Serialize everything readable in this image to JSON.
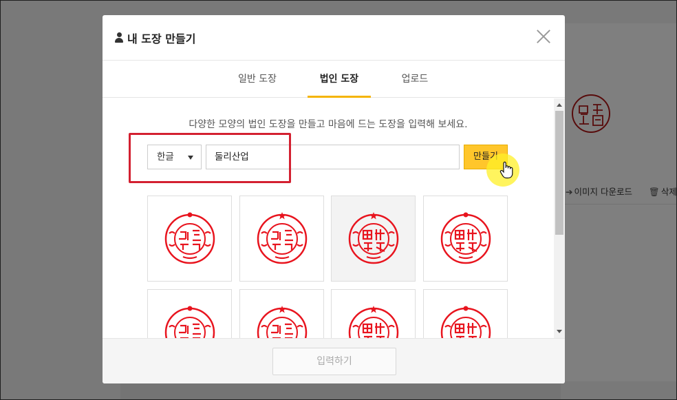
{
  "background": {
    "actions": {
      "download_label": "이미지 다운로드",
      "delete_label": "삭제"
    }
  },
  "modal": {
    "title": "내 도장 만들기",
    "tabs": [
      {
        "label": "일반 도장",
        "active": false
      },
      {
        "label": "법인 도장",
        "active": true
      },
      {
        "label": "업로드",
        "active": false
      }
    ],
    "description": "다양한 모양의 법인 도장을 만들고 마음에 드는 도장을 입력해 보세요.",
    "language_select": {
      "selected": "한글"
    },
    "name_input": {
      "value": "둘리산업"
    },
    "make_button": {
      "label": "만들기"
    },
    "submit_button": {
      "label": "입력하기"
    }
  },
  "colors": {
    "accent": "#ffc62b",
    "tab_underline": "#f5b400",
    "seal_red": "#e8141e",
    "highlight": "#d32030"
  }
}
